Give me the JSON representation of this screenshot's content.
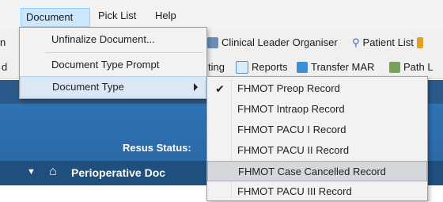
{
  "menubar": {
    "items": [
      "Document",
      "Pick List",
      "Help"
    ]
  },
  "toolbar1": {
    "partial_left": "n",
    "clinical_leader": "Clinical Leader Organiser",
    "patient_list": "Patient List"
  },
  "toolbar2": {
    "partial_left": "d",
    "partial_charting": "ting",
    "reports": "Reports",
    "transfer_mar": "Transfer MAR",
    "path": "Path L"
  },
  "banner": {
    "resus_status": "Resus Status:"
  },
  "navbar": {
    "perioperative_doc": "Perioperative Doc"
  },
  "document_menu": {
    "items": [
      {
        "label": "Unfinalize Document..."
      },
      {
        "label": "Document Type Prompt"
      },
      {
        "label": "Document Type"
      }
    ]
  },
  "document_type_submenu": {
    "checked_label": "✔",
    "items": [
      {
        "label": "FHMOT Preop Record",
        "checked": true
      },
      {
        "label": "FHMOT Intraop Record"
      },
      {
        "label": "FHMOT PACU I Record"
      },
      {
        "label": "FHMOT PACU II Record"
      },
      {
        "label": "FHMOT Case Cancelled Record",
        "highlighted": true
      },
      {
        "label": "FHMOT PACU III Record"
      }
    ]
  },
  "colors": {
    "banner_blue": "#2f72b4",
    "nav_blue": "#1e4f7d",
    "menu_hover": "#dbe7f4"
  }
}
